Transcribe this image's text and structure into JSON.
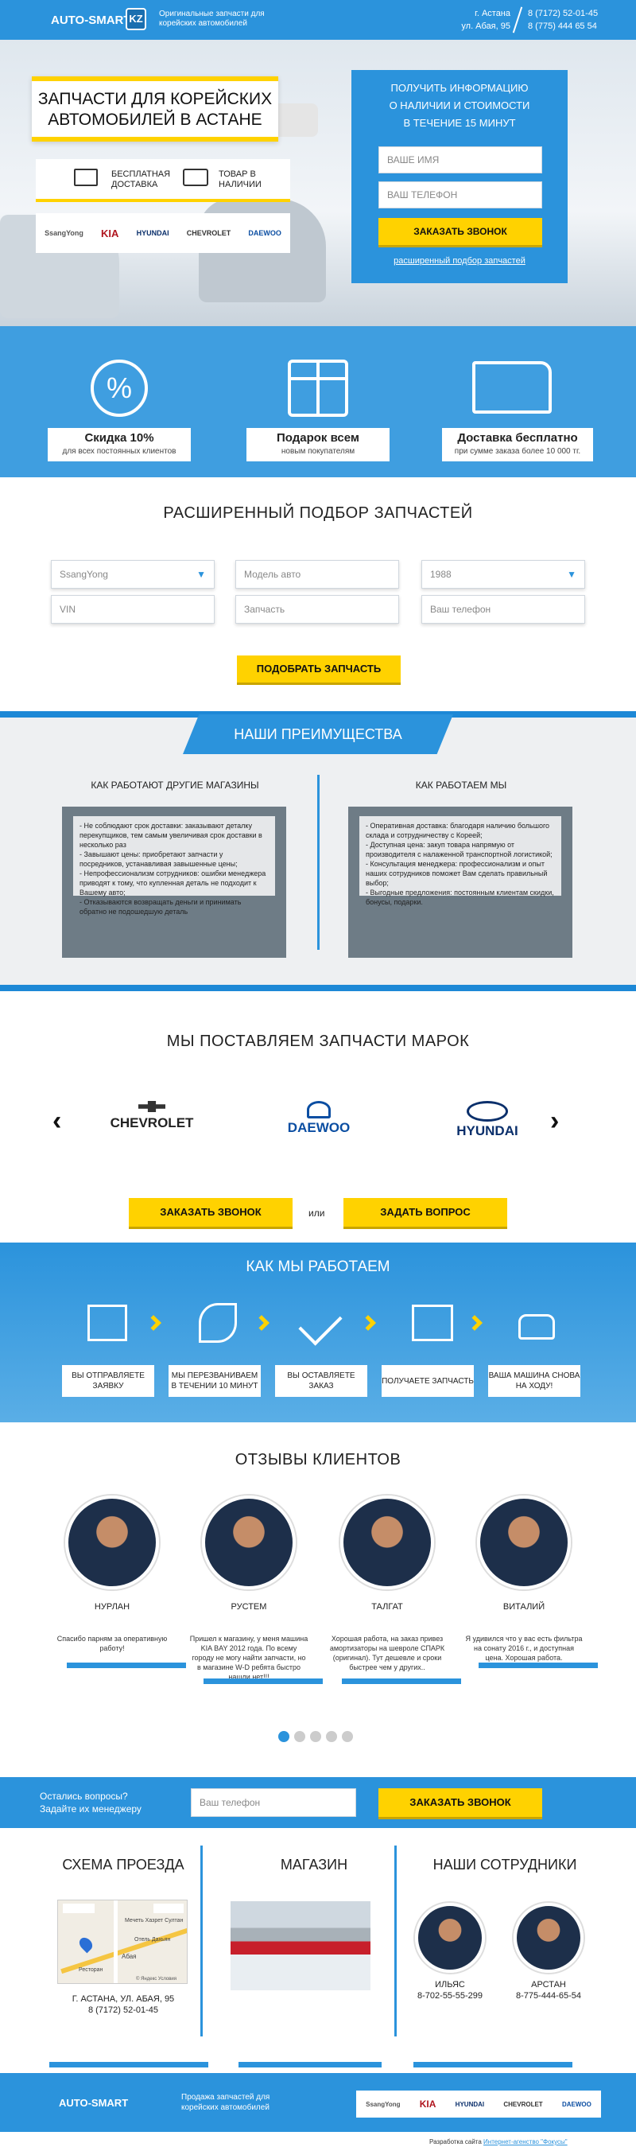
{
  "colors": {
    "accent": "#2b93dc",
    "yellow": "#ffd200"
  },
  "header": {
    "logo": "AUTO-SMART",
    "logo_badge": "KZ",
    "tagline": "Оригинальные запчасти для корейских автомобилей",
    "city": "г. Астана",
    "address": "ул. Абая, 95",
    "phone1": "8 (7172) 52-01-45",
    "phone2": "8 (775) 444 65 54"
  },
  "hero": {
    "title_line1": "ЗАПЧАСТИ ДЛЯ КОРЕЙСКИХ",
    "title_line2": "АВТОМОБИЛЕЙ В АСТАНЕ",
    "perk1_line1": "БЕСПЛАТНАЯ",
    "perk1_line2": "ДОСТАВКА",
    "perk2_line1": "ТОВАР В",
    "perk2_line2": "НАЛИЧИИ",
    "brands": [
      "SsangYong",
      "KIA",
      "HYUNDAI",
      "CHEVROLET",
      "DAEWOO"
    ],
    "form": {
      "title_line1": "ПОЛУЧИТЬ ИНФОРМАЦИЮ",
      "title_line2": "О НАЛИЧИИ И СТОИМОСТИ",
      "title_line3": "В ТЕЧЕНИЕ 15 МИНУТ",
      "name_placeholder": "ВАШЕ ИМЯ",
      "phone_placeholder": "ВАШ ТЕЛЕФОН",
      "button": "ЗАКАЗАТЬ ЗВОНОК",
      "link": "расширенный подбор запчастей"
    }
  },
  "features": [
    {
      "title": "Скидка 10%",
      "sub": "для всех постоянных клиентов",
      "icon": "percent-icon",
      "glyph": "%"
    },
    {
      "title": "Подарок всем",
      "sub": "новым покупателям",
      "icon": "gift-icon",
      "glyph": "🎁"
    },
    {
      "title": "Доставка бесплатно",
      "sub": "при сумме заказа более 10 000 тг.",
      "icon": "truck-icon",
      "glyph": "🚚"
    }
  ],
  "search": {
    "title": "РАСШИРЕННЫЙ ПОДБОР ЗАПЧАСТЕЙ",
    "brand_select": "SsangYong",
    "model_placeholder": "Модель авто",
    "year_select": "1988",
    "vin_placeholder": "VIN",
    "part_placeholder": "Запчасть",
    "phone_placeholder": "Ваш телефон",
    "button": "ПОДОБРАТЬ ЗАПЧАСТЬ"
  },
  "advantages": {
    "title": "НАШИ ПРЕИМУЩЕСТВА",
    "left_title": "КАК РАБОТАЮТ ДРУГИЕ МАГАЗИНЫ",
    "right_title": "КАК РАБОТАЕМ МЫ",
    "left_items": [
      "- Не соблюдают срок доставки: заказывают деталку перекупщиков, тем самым увеличивая срок доставки в несколько раз",
      "- Завышают цены: приобретают запчасти у посредников, устанавливая завышенные цены;",
      "- Непрофессионализм сотрудников: ошибки менеджера приводят к тому, что купленная деталь не подходит к Вашему авто;",
      "- Отказываются возвращать деньги и принимать обратно не подошедшую деталь"
    ],
    "right_items": [
      "- Оперативная доставка: благодаря наличию большого склада и сотрудничеству с Кореей;",
      "- Доступная цена: закуп товара напрямую от производителя с налаженной транспортной логистикой;",
      "- Консультация менеджера: профессионализм и опыт наших сотрудников поможет Вам сделать правильный выбор;",
      "- Выгодные предложения: постоянным клиентам скидки, бонусы, подарки."
    ]
  },
  "brands_section": {
    "title": "МЫ ПОСТАВЛЯЕМ ЗАПЧАСТИ МАРОК",
    "items": [
      "CHEVROLET",
      "DAEWOO",
      "HYUNDAI"
    ],
    "btn_call": "ЗАКАЗАТЬ ЗВОНОК",
    "or": "или",
    "btn_ask": "ЗАДАТЬ ВОПРОС"
  },
  "how": {
    "title": "КАК МЫ РАБОТАЕМ",
    "steps": [
      "ВЫ ОТПРАВЛЯЕТЕ ЗАЯВКУ",
      "МЫ ПЕРЕЗВАНИВАЕМ В ТЕЧЕНИИ 10 МИНУТ",
      "ВЫ ОСТАВЛЯЕТЕ ЗАКАЗ",
      "ПОЛУЧАЕТЕ ЗАПЧАСТЬ",
      "ВАША МАШИНА СНОВА НА ХОДУ!"
    ]
  },
  "reviews": {
    "title": "ОТЗЫВЫ КЛИЕНТОВ",
    "items": [
      {
        "name": "НУРЛАН",
        "text": "Спасибо парням за оперативную работу!"
      },
      {
        "name": "РУСТЕМ",
        "text": "Пришел к магазину, у меня машина KIA BAY 2012 года. По всему городу не могу найти запчасти, но в магазине W-D ребята быстро нашли нет!!!"
      },
      {
        "name": "ТАЛГАТ",
        "text": "Хорошая работа, на заказ привез амортизаторы на шевроле СПАРК (оригинал). Тут дешевле и сроки быстрее чем у других.."
      },
      {
        "name": "ВИТАЛИЙ",
        "text": "Я удивился что у вас есть фильтра на сонату 2016 г., и доступная цена. Хорошая работа."
      }
    ]
  },
  "cta": {
    "line1": "Остались вопросы?",
    "line2": "Задайте их менеджеру",
    "phone_placeholder": "Ваш телефон",
    "button": "ЗАКАЗАТЬ ЗВОНОК"
  },
  "bottom": {
    "map_title": "СХЕМА ПРОЕЗДА",
    "shop_title": "МАГАЗИН",
    "staff_title": "НАШИ СОТРУДНИКИ",
    "address": "Г. АСТАНА, УЛ. АБАЯ, 95",
    "phone": "8 (7172) 52-01-45",
    "map_labels": [
      "Абая",
      "Мечеть Хазрет Султан",
      "Отель Дахьян",
      "Ресторан"
    ],
    "map_footer": "© Яндекс  Условия",
    "staff": [
      {
        "name": "ИЛЬЯС",
        "phone": "8-702-55-55-299"
      },
      {
        "name": "АРСТАН",
        "phone": "8-775-444-65-54"
      }
    ]
  },
  "footer": {
    "logo": "AUTO-SMART",
    "tagline_line1": "Продажа запчастей для",
    "tagline_line2": "корейских автомобилей",
    "brands": [
      "SsangYong",
      "KIA",
      "HYUNDAI",
      "CHEVROLET",
      "DAEWOO"
    ],
    "credit_prefix": "Разработка сайта ",
    "credit_link": "Интернет-агенство \"Фокусы\""
  }
}
